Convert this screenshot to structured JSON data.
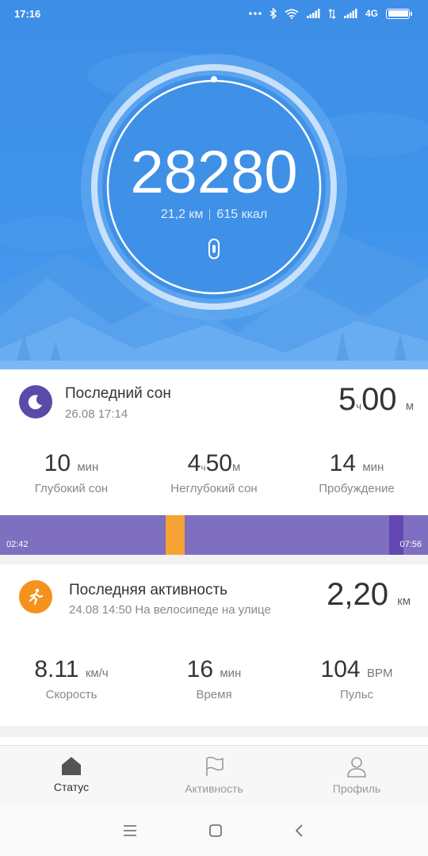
{
  "status_bar": {
    "time": "17:16",
    "network": "4G",
    "icons": [
      "more-dots-icon",
      "bluetooth-icon",
      "wifi-icon",
      "signal-icon",
      "data-icon",
      "signal-icon",
      "battery-icon"
    ],
    "battery_level": 1.0
  },
  "hero": {
    "steps": "28280",
    "distance": "21,2 км",
    "calories": "615 ккал",
    "ring_progress": 1.0,
    "device_icon": "band-icon"
  },
  "sleep": {
    "title": "Последний сон",
    "date": "26.08 17:14",
    "total_hours": "5",
    "total_hours_unit": "ч",
    "total_minutes": "00",
    "total_minutes_unit": "м",
    "icon": "moon-sleep-icon",
    "stats": [
      {
        "value": "10",
        "unit": "мин",
        "label": "Глубокий сон"
      },
      {
        "value_h": "4",
        "unit_h": "ч",
        "value_m": "50",
        "unit_m": "м",
        "label": "Неглубокий сон"
      },
      {
        "value": "14",
        "unit": "мин",
        "label": "Пробуждение"
      }
    ],
    "start_time": "02:42",
    "end_time": "07:56"
  },
  "activity": {
    "title": "Последняя активность",
    "subtitle": "24.08 14:50 На велосипеде на улице",
    "distance": "2,20",
    "distance_unit": "км",
    "icon": "running-icon",
    "stats": [
      {
        "value": "8.11",
        "unit": "км/ч",
        "label": "Скорость"
      },
      {
        "value": "16",
        "unit": "мин",
        "label": "Время"
      },
      {
        "value": "104",
        "unit": "BPM",
        "label": "Пульс"
      }
    ]
  },
  "tabs": [
    {
      "label": "Статус",
      "icon": "home-icon",
      "active": true
    },
    {
      "label": "Активность",
      "icon": "flag-icon",
      "active": false
    },
    {
      "label": "Профиль",
      "icon": "person-icon",
      "active": false
    }
  ],
  "colors": {
    "hero_blue": "#3f93ea",
    "sleep_purple": "#7e6fc0",
    "sleep_awake": "#f7a235",
    "sleep_deep": "#6347b3",
    "activity_orange": "#f5921e",
    "sleep_icon": "#5b4aa8"
  }
}
